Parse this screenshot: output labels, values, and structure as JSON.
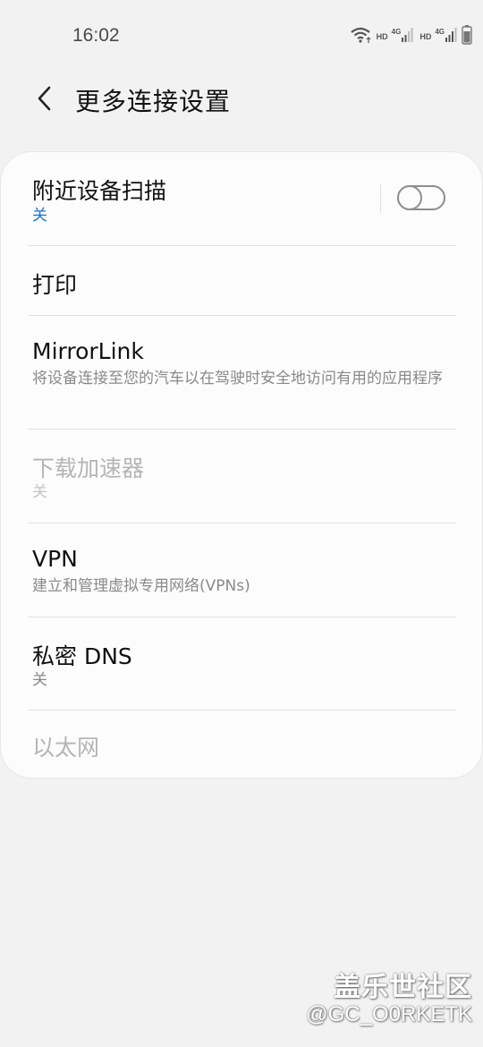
{
  "status_bar": {
    "time": "16:02",
    "hd_1": "HD",
    "net_1": "4G",
    "hd_2": "HD",
    "net_2": "4G"
  },
  "header": {
    "title": "更多连接设置"
  },
  "settings": [
    {
      "title": "附近设备扫描",
      "subtitle": "关",
      "toggle_on": false
    },
    {
      "title": "打印"
    },
    {
      "title": "MirrorLink",
      "subtitle": "将设备连接至您的汽车以在驾驶时安全地访问有用的应用程序"
    },
    {
      "title": "下载加速器",
      "subtitle": "关",
      "enabled": false
    },
    {
      "title": "VPN",
      "subtitle": "建立和管理虚拟专用网络(VPNs)"
    },
    {
      "title": "私密 DNS",
      "subtitle": "关"
    },
    {
      "title": "以太网",
      "enabled": false
    }
  ],
  "colors": {
    "accent": "#1a72c4",
    "background": "#f2f2f2",
    "card": "#fcfcfc"
  },
  "watermark": {
    "line1": "盖乐世社区",
    "line2": "@GC_O0RKETK"
  }
}
